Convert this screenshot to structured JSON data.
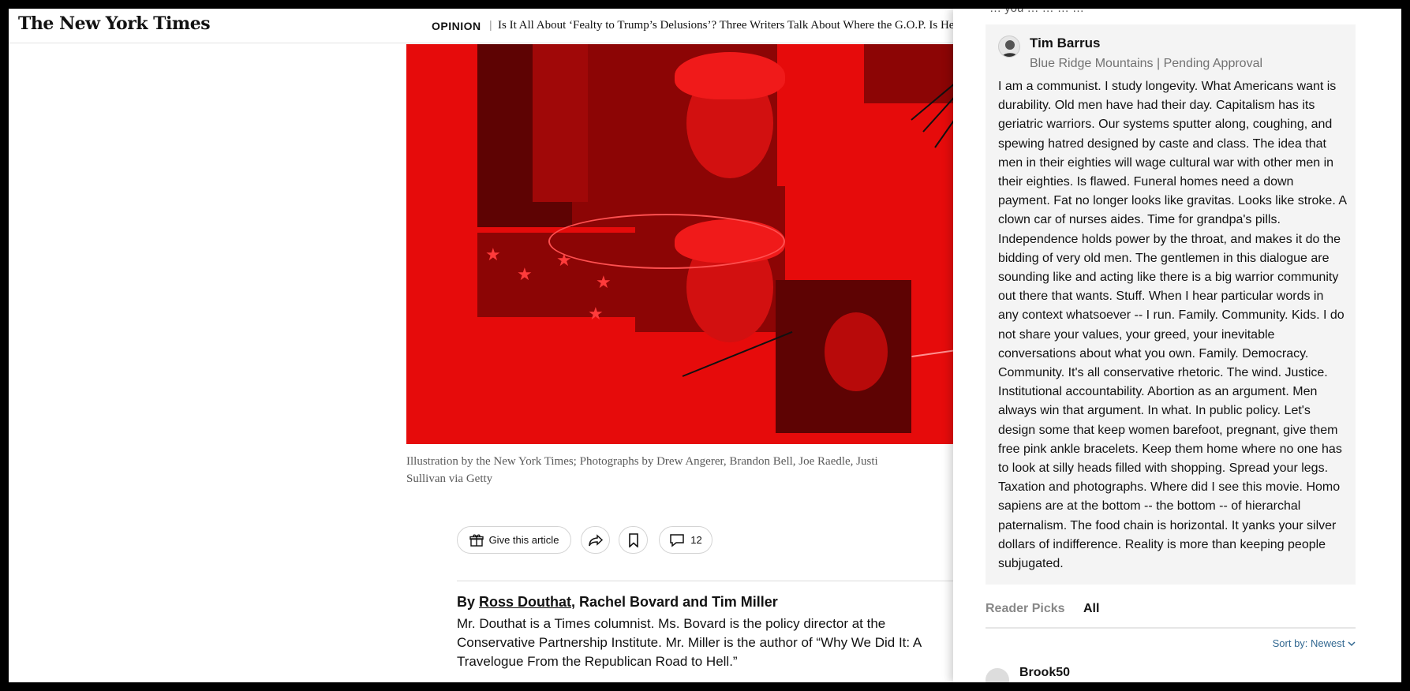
{
  "header": {
    "logo": "The New York Times",
    "section": "OPINION",
    "headline": "Is It All About ‘Fealty to Trump’s Delusions’? Three Writers Talk About Where the G.O.P. Is Hea"
  },
  "article": {
    "caption_line1": "Illustration by the New York Times; Photographs by Drew Angerer, Brandon Bell, Joe Raedle, Justi",
    "caption_line2": "Sullivan via Getty",
    "actions": {
      "gift_label": "Give this article",
      "comment_count": "12"
    },
    "byline": {
      "prefix": "By ",
      "author_link": "Ross Douthat",
      "rest": ", Rachel Bovard and Tim Miller"
    },
    "bio": "Mr. Douthat is a Times columnist. Ms. Bovard is the policy director at the Conservative Partnership Institute. Mr. Miller is the author of “Why We Did It: A Travelogue From the Republican Road to Hell.”"
  },
  "comments": {
    "clipped_text": "… you … … … …",
    "featured": {
      "name": "Tim Barrus",
      "meta": "Blue Ridge Mountains | Pending Approval",
      "body": "I am a communist. I study longevity. What Americans want is durability. Old men have had their day. Capitalism has its geriatric warriors. Our systems sputter along, coughing, and spewing hatred designed by caste and class. The idea that men in their eighties will wage cultural war with other men in their eighties. Is flawed. Funeral homes need a down payment. Fat no longer looks like gravitas. Looks like stroke. A clown car of nurses aides. Time for grandpa's pills. Independence holds power by the throat, and makes it do the bidding of very old men. The gentlemen in this dialogue are sounding like and acting like there is a big warrior community out there that wants. Stuff.  When I hear particular words in any context whatsoever -- I run. Family. Community. Kids. I do not share your values, your greed, your inevitable conversations about what you own. Family. Democracy. Community. It's all conservative rhetoric. The wind. Justice. Institutional accountability. Abortion as an argument. Men always win that argument. In what. In public policy. Let's design some that keep women barefoot, pregnant, give them free pink ankle bracelets. Keep them home where no one has to look at silly heads filled with shopping. Spread your legs. Taxation and photographs. Where did I see this movie. Homo sapiens are at the bottom -- the bottom -- of hierarchal paternalism. The food chain is horizontal. It yanks your silver dollars of indifference. Reality is more than keeping people subjugated."
    },
    "tabs": [
      "Reader Picks",
      "All"
    ],
    "sort_label": "Sort by: Newest",
    "next_commenter": "Brook50"
  },
  "colors": {
    "hero_red": "#e60b0b",
    "link_blue": "#326891"
  },
  "icons": [
    "gift-icon",
    "share-icon",
    "bookmark-icon",
    "comment-icon",
    "chevron-down-icon"
  ]
}
